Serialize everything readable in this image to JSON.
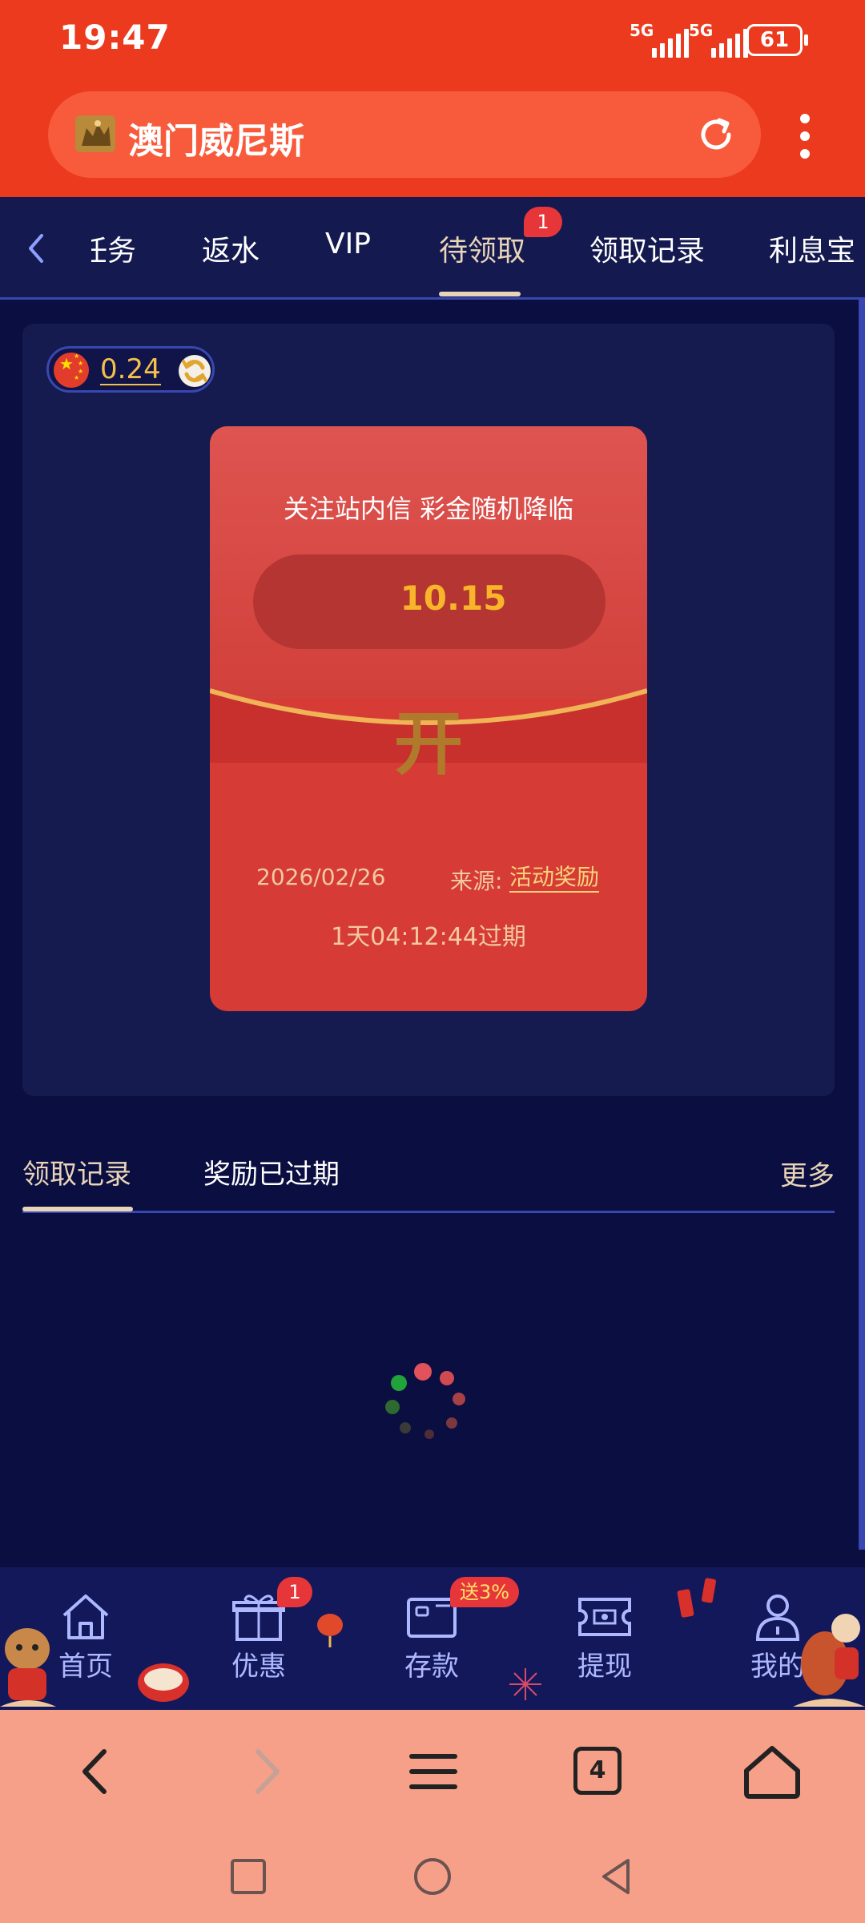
{
  "status_bar": {
    "time": "19:47",
    "network_1": "5G",
    "network_2": "5G",
    "battery": "61"
  },
  "browser": {
    "site_name": "澳门威尼斯"
  },
  "tabs": [
    {
      "label": "任务"
    },
    {
      "label": "返水"
    },
    {
      "label": "VIP"
    },
    {
      "label": "待领取",
      "active": true,
      "badge": "1"
    },
    {
      "label": "领取记录"
    },
    {
      "label": "利息宝"
    }
  ],
  "balance": {
    "amount": "0.24"
  },
  "envelope": {
    "slogan": "关注站内信 彩金随机降临",
    "amount": "10.15",
    "open_label": "开",
    "date": "2026/02/26",
    "source_label": "来源:",
    "source_value": "活动奖励",
    "expiry": "1天04:12:44过期"
  },
  "records": {
    "tab_claimed": "领取记录",
    "tab_expired": "奖励已过期",
    "more": "更多"
  },
  "bottom_nav": {
    "home": "首页",
    "offers": "优惠",
    "offers_badge": "1",
    "deposit": "存款",
    "deposit_badge": "送3%",
    "withdraw": "提现",
    "mine": "我的"
  },
  "toolbar": {
    "tab_count": "4"
  },
  "colors": {
    "header_red": "#ec3a1e",
    "page_navy": "#0b0e40",
    "envelope_red": "#d63b36",
    "gold": "#f8b52a",
    "accent_blue": "#3848b0"
  }
}
